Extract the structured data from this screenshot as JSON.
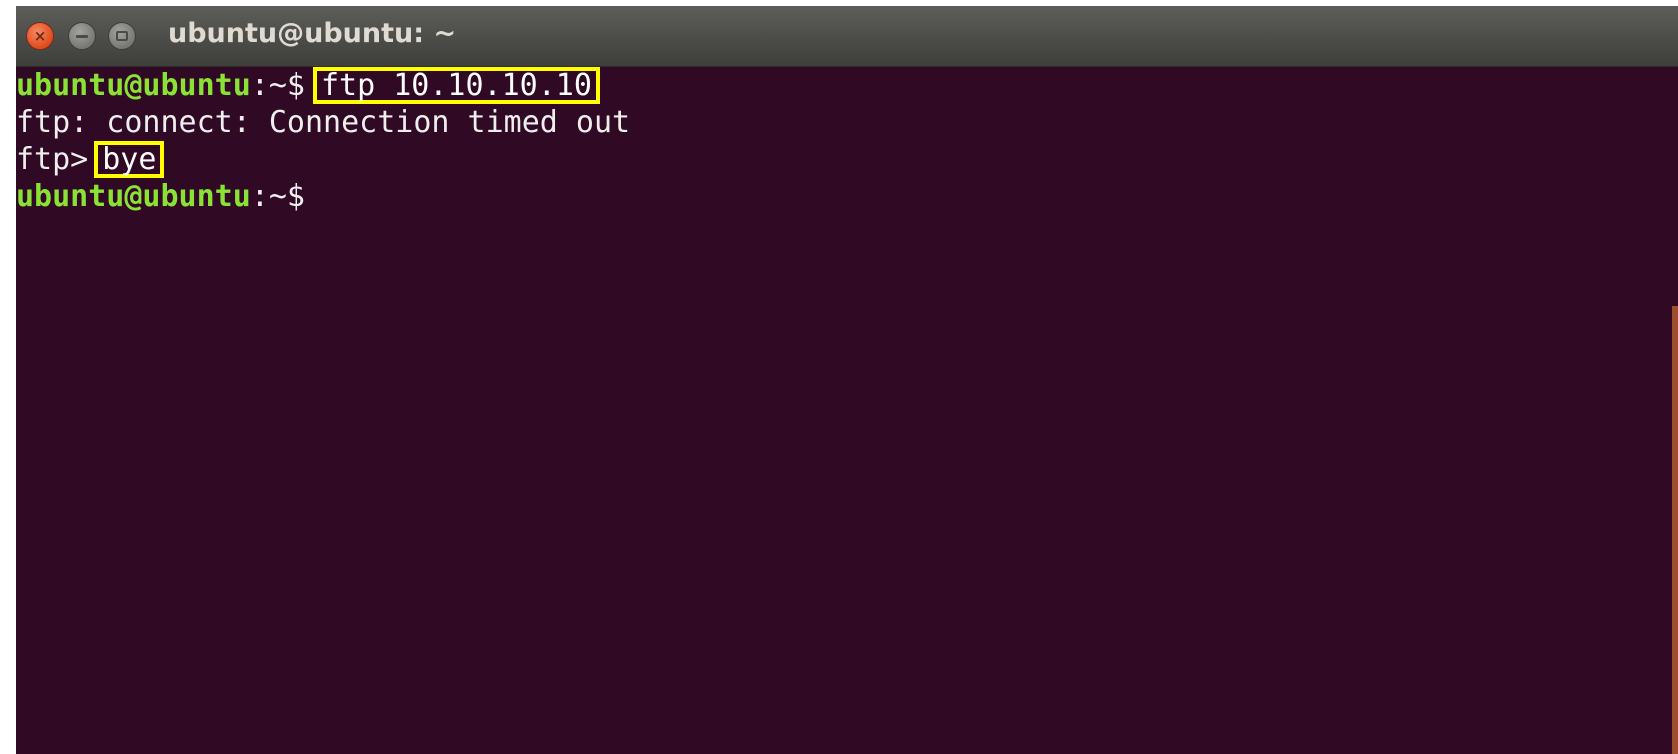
{
  "window": {
    "title": "ubuntu@ubuntu: ~",
    "close_icon": "close-icon",
    "minimize_icon": "minimize-icon",
    "maximize_icon": "maximize-icon"
  },
  "terminal": {
    "lines": [
      {
        "prompt_user": "ubuntu@ubuntu",
        "prompt_path": ":~$",
        "command": "ftp 10.10.10.10",
        "highlighted": true
      },
      {
        "output": "ftp: connect: Connection timed out"
      },
      {
        "prompt": "ftp>",
        "command": "bye",
        "highlighted": true
      },
      {
        "prompt_user": "ubuntu@ubuntu",
        "prompt_path": ":~$"
      }
    ]
  },
  "colors": {
    "background": "#300a24",
    "prompt_user": "#8ae234",
    "text": "#eeeeec",
    "highlight_box": "#ffff00",
    "titlebar": "#4a4a47",
    "close_button": "#df4b1c"
  }
}
